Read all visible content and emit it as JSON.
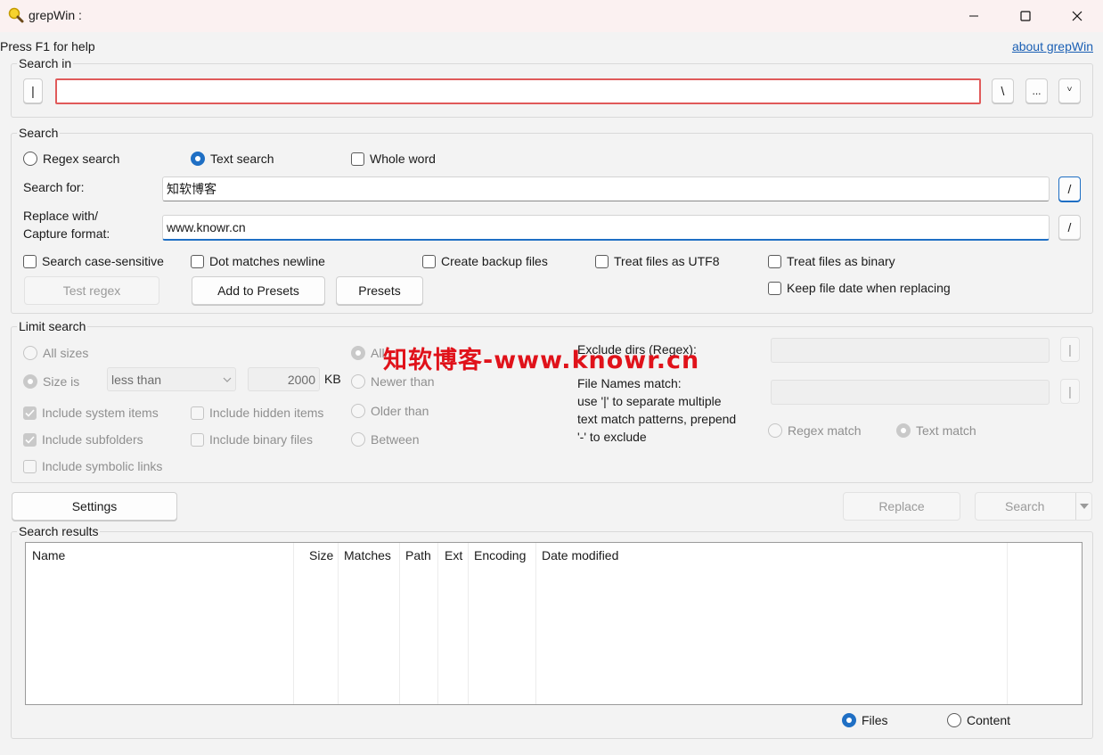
{
  "window": {
    "title": "grepWin :",
    "help_text": "Press F1 for help",
    "about_link": "about grepWin"
  },
  "search_in": {
    "label": "Search in",
    "prefix_button": "|",
    "path_value": "",
    "backslash_button": "\\",
    "browse_button": "...",
    "history_button": "ⱽ"
  },
  "search": {
    "label": "Search",
    "regex_search": "Regex search",
    "text_search": "Text search",
    "whole_word": "Whole word",
    "search_for_label": "Search for:",
    "search_for_value": "知软博客",
    "search_for_button": "/",
    "replace_label_1": "Replace with/",
    "replace_label_2": "Capture format:",
    "replace_value": "www.knowr.cn",
    "replace_button": "/",
    "case_sensitive": "Search case-sensitive",
    "dot_newline": "Dot matches newline",
    "backup_files": "Create backup files",
    "treat_utf8": "Treat files as UTF8",
    "treat_binary": "Treat files as binary",
    "keep_date": "Keep file date when replacing",
    "test_regex": "Test regex",
    "add_presets": "Add to Presets",
    "presets": "Presets"
  },
  "limit": {
    "label": "Limit search",
    "all_sizes": "All sizes",
    "size_is": "Size is",
    "size_op": "less than",
    "size_value": "2000",
    "size_unit": "KB",
    "include_system": "Include system items",
    "include_hidden": "Include hidden items",
    "include_subfolders": "Include subfolders",
    "include_binary": "Include binary files",
    "include_symlinks": "Include symbolic links",
    "all_dates": "All",
    "newer_than": "Newer than",
    "older_than": "Older than",
    "between": "Between",
    "exclude_dirs": "Exclude dirs (Regex):",
    "file_names_1": "File Names match:",
    "file_names_2": "use '|' to separate multiple",
    "file_names_3": "text match patterns, prepend",
    "file_names_4": "'-' to exclude",
    "exclude_btn": "|",
    "names_btn": "|",
    "regex_match": "Regex match",
    "text_match": "Text match"
  },
  "actions": {
    "settings": "Settings",
    "replace": "Replace",
    "search": "Search"
  },
  "results": {
    "label": "Search results",
    "columns": [
      "Name",
      "Size",
      "Matches",
      "Path",
      "Ext",
      "Encoding",
      "Date modified"
    ],
    "show_files": "Files",
    "show_content": "Content"
  },
  "watermark": "知软博客-www.knowr.cn",
  "colors": {
    "accent": "#1f6fc4",
    "error_border": "#e05a5a",
    "watermark": "#e0121a"
  }
}
